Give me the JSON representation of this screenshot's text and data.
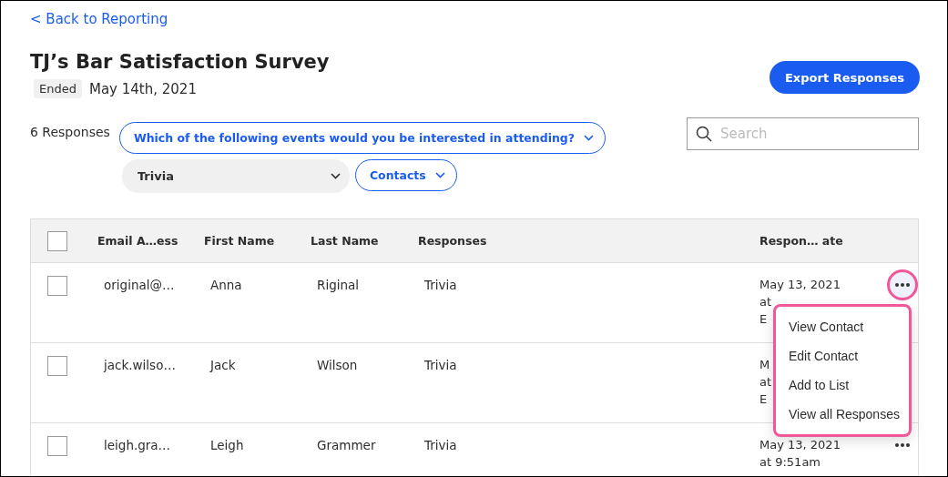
{
  "back_link": "< Back to Reporting",
  "title": "TJ’s Bar Satisfaction Survey",
  "status_badge": "Ended",
  "date": "May 14th, 2021",
  "export_button": "Export Responses",
  "response_count": "6 Responses",
  "question_filter": "Which of the following events would you be interested in attending?",
  "answer_filter": "Trivia",
  "audience_filter": "Contacts",
  "search": {
    "placeholder": "Search"
  },
  "table": {
    "columns": [
      "Email A…ess",
      "First Name",
      "Last Name",
      "Responses",
      "Respon… ate"
    ],
    "header_checked": false,
    "rows": [
      {
        "checked": false,
        "cells": [
          "original@…",
          "Anna",
          "Riginal",
          "Trivia"
        ],
        "date_lines": [
          "May 13, 2021",
          "at",
          "E"
        ],
        "menu_open": true
      },
      {
        "checked": false,
        "cells": [
          "jack.wilso…",
          "Jack",
          "Wilson",
          "Trivia"
        ],
        "date_lines": [
          "M",
          "at",
          "E"
        ]
      },
      {
        "checked": false,
        "cells": [
          "leigh.gra…",
          "Leigh",
          "Grammer",
          "Trivia"
        ],
        "date_lines": [
          "May 13, 2021",
          "at 9:51am"
        ],
        "menu_open": false
      }
    ]
  },
  "row_menu": [
    "View Contact",
    "Edit Contact",
    "Add to List",
    "View all Responses"
  ]
}
